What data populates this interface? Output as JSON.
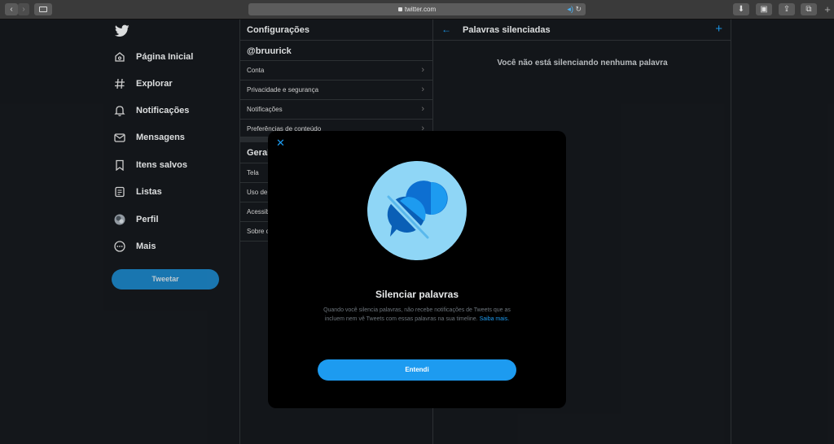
{
  "browser": {
    "url": "twitter.com"
  },
  "nav": {
    "items": [
      {
        "label": "Página Inicial",
        "icon": "home-icon"
      },
      {
        "label": "Explorar",
        "icon": "hashtag-icon"
      },
      {
        "label": "Notificações",
        "icon": "bell-icon"
      },
      {
        "label": "Mensagens",
        "icon": "mail-icon"
      },
      {
        "label": "Itens salvos",
        "icon": "bookmark-icon"
      },
      {
        "label": "Listas",
        "icon": "list-icon"
      },
      {
        "label": "Perfil",
        "icon": "avatar-icon"
      },
      {
        "label": "Mais",
        "icon": "more-icon"
      }
    ],
    "tweet_label": "Tweetar"
  },
  "settings": {
    "title": "Configurações",
    "username": "@bruurick",
    "items": [
      "Conta",
      "Privacidade e segurança",
      "Notificações",
      "Preferências de conteúdo"
    ],
    "general_title": "Geral",
    "general_items": [
      "Tela",
      "Uso de",
      "Acessib",
      "Sobre o"
    ]
  },
  "muted": {
    "title": "Palavras silenciadas",
    "empty_text": "Você não está silenciando nenhuma palavra"
  },
  "modal": {
    "title": "Silenciar palavras",
    "description": "Quando você silencia palavras, não recebe notificações de Tweets que as incluem nem vê Tweets com essas palavras na sua timeline.",
    "link": "Saiba mais.",
    "button": "Entendi"
  },
  "colors": {
    "accent": "#1d9bf0",
    "background": "#15181c",
    "modal": "#000000"
  }
}
